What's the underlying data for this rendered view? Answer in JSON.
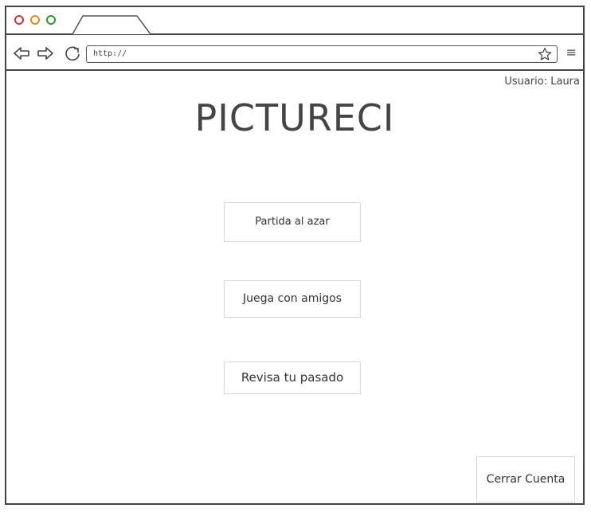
{
  "theme": {
    "red": "#c0393b",
    "orange": "#e08a1e",
    "green": "#2f9a2f"
  },
  "browser": {
    "url": "http://",
    "icons": {
      "back": "back-arrow-icon",
      "forward": "forward-arrow-icon",
      "reload": "reload-icon",
      "bookmark": "star-icon",
      "menu": "hamburger-menu-icon"
    },
    "menu_glyph": "≡"
  },
  "header": {
    "user_label": "Usuario: Laura"
  },
  "app": {
    "title": "PICTURECI"
  },
  "menu": {
    "random_game": "Partida al azar",
    "play_with_friends": "Juega con amigos",
    "review_past": "Revisa tu pasado"
  },
  "footer": {
    "logout": "Cerrar Cuenta"
  }
}
